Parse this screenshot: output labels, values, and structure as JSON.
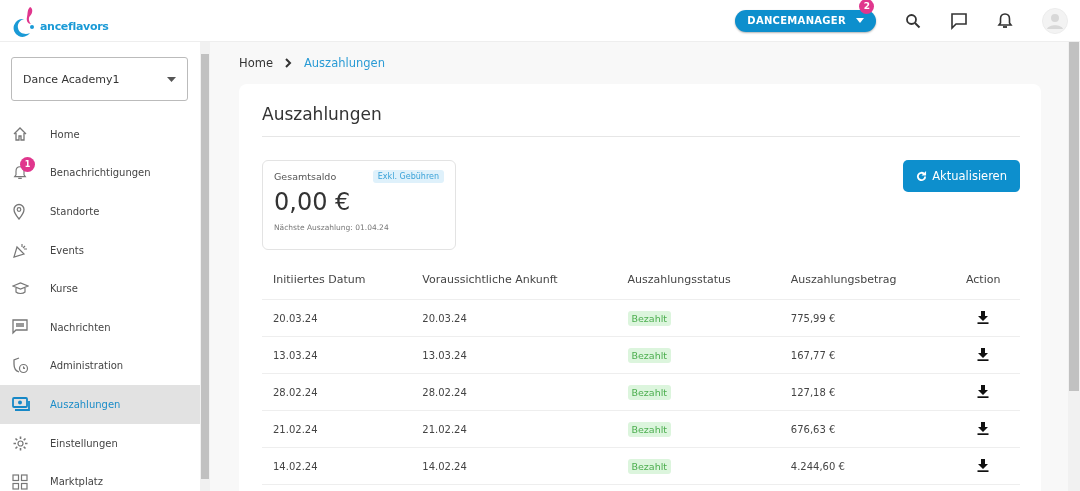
{
  "header": {
    "logo_text": "anceflavors",
    "role_button": "DANCEMANAGER",
    "role_badge": "2"
  },
  "sidebar": {
    "school_select": "Dance Academy1",
    "items": [
      {
        "label": "Home",
        "selected": false
      },
      {
        "label": "Benachrichtigungen",
        "selected": false,
        "badge": "1"
      },
      {
        "label": "Standorte",
        "selected": false
      },
      {
        "label": "Events",
        "selected": false
      },
      {
        "label": "Kurse",
        "selected": false
      },
      {
        "label": "Nachrichten",
        "selected": false
      },
      {
        "label": "Administration",
        "selected": false
      },
      {
        "label": "Auszahlungen",
        "selected": true
      },
      {
        "label": "Einstellungen",
        "selected": false
      },
      {
        "label": "Marktplatz",
        "selected": false
      }
    ]
  },
  "breadcrumb": [
    "Home",
    "Auszahlungen"
  ],
  "page_title": "Auszahlungen",
  "balance": {
    "label": "Gesamtsaldo",
    "tag": "Exkl. Gebühren",
    "amount": "0,00 €",
    "next_payout": "Nächste Auszahlung: 01.04.24"
  },
  "refresh_button": "Aktualisieren",
  "table": {
    "columns": [
      "Initiiertes Datum",
      "Voraussichtliche Ankunft",
      "Auszahlungsstatus",
      "Auszahlungsbetrag",
      "Action"
    ],
    "rows": [
      {
        "initiated": "20.03.24",
        "arrival": "20.03.24",
        "status": "Bezahlt",
        "amount": "775,99 €"
      },
      {
        "initiated": "13.03.24",
        "arrival": "13.03.24",
        "status": "Bezahlt",
        "amount": "167,77 €"
      },
      {
        "initiated": "28.02.24",
        "arrival": "28.02.24",
        "status": "Bezahlt",
        "amount": "127,18 €"
      },
      {
        "initiated": "21.02.24",
        "arrival": "21.02.24",
        "status": "Bezahlt",
        "amount": "676,63 €"
      },
      {
        "initiated": "14.02.24",
        "arrival": "14.02.24",
        "status": "Bezahlt",
        "amount": "4.244,60 €"
      }
    ]
  }
}
